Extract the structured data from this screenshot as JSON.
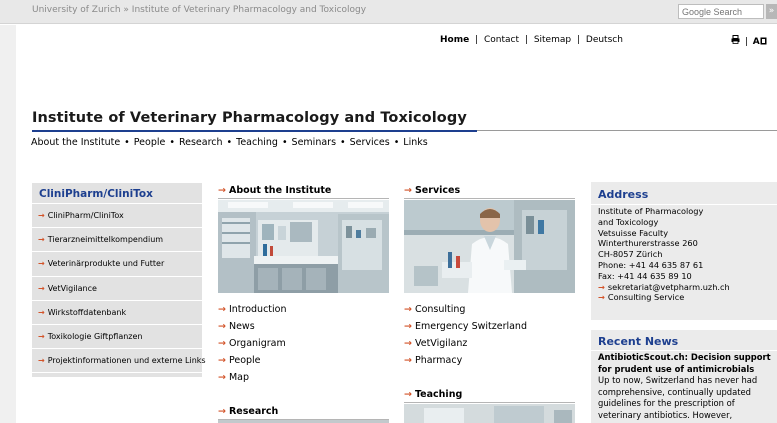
{
  "breadcrumb": {
    "university": "University of Zurich",
    "separator": "»",
    "institute": "Institute of Veterinary Pharmacology and Toxicology"
  },
  "search": {
    "placeholder": "Google Search",
    "button_label": "»"
  },
  "utility_nav": {
    "home": "Home",
    "contact": "Contact",
    "sitemap": "Sitemap",
    "deutsch": "Deutsch",
    "separator": "|"
  },
  "utility_icons": {
    "print_icon": "printer-icon",
    "separator": "|",
    "text_size_icon": "text-size-icon",
    "text_size_label": "A"
  },
  "page_title": "Institute of Veterinary Pharmacology and Toxicology",
  "main_nav": {
    "items": [
      "About the Institute",
      "People",
      "Research",
      "Teaching",
      "Seminars",
      "Services",
      "Links"
    ],
    "separator": "•"
  },
  "sidebar": {
    "title": "CliniPharm/CliniTox",
    "items": [
      "CliniPharm/CliniTox",
      "Tierarzneimittelkompendium",
      "Veterinärprodukte und Futter",
      "VetVigilance",
      "Wirkstoffdatenbank",
      "Toxikologie Giftpflanzen",
      "Projektinformationen und externe Links"
    ]
  },
  "about": {
    "heading": "About the Institute",
    "links": [
      "Introduction",
      "News",
      "Organigram",
      "People",
      "Map"
    ]
  },
  "services": {
    "heading": "Services",
    "links": [
      "Consulting",
      "Emergency Switzerland",
      "VetVigilanz",
      "Pharmacy"
    ]
  },
  "research": {
    "heading": "Research"
  },
  "teaching": {
    "heading": "Teaching"
  },
  "address": {
    "title": "Address",
    "lines": [
      "Institute of Pharmacology",
      "and Toxicology",
      "Vetsuisse Faculty",
      "Winterthurerstrasse 260",
      "CH-8057 Zürich",
      "Phone: +41 44 635 87 61",
      "Fax: +41 44 635 89 10"
    ],
    "email": "sekretariat@vetpharm.uzh.ch",
    "consulting": "Consulting Service"
  },
  "news": {
    "title": "Recent News",
    "headline": "AntibioticScout.ch: Decision support for prudent use of antimicrobials",
    "body": "Up to now, Switzerland has never had comprehensive, continually updated guidelines for the prescription of veterinary antibiotics. However,"
  },
  "colors": {
    "accent_blue": "#1d3f8f",
    "arrow_orange": "#d3542a",
    "sidebar_grey": "#e2e2e2"
  }
}
